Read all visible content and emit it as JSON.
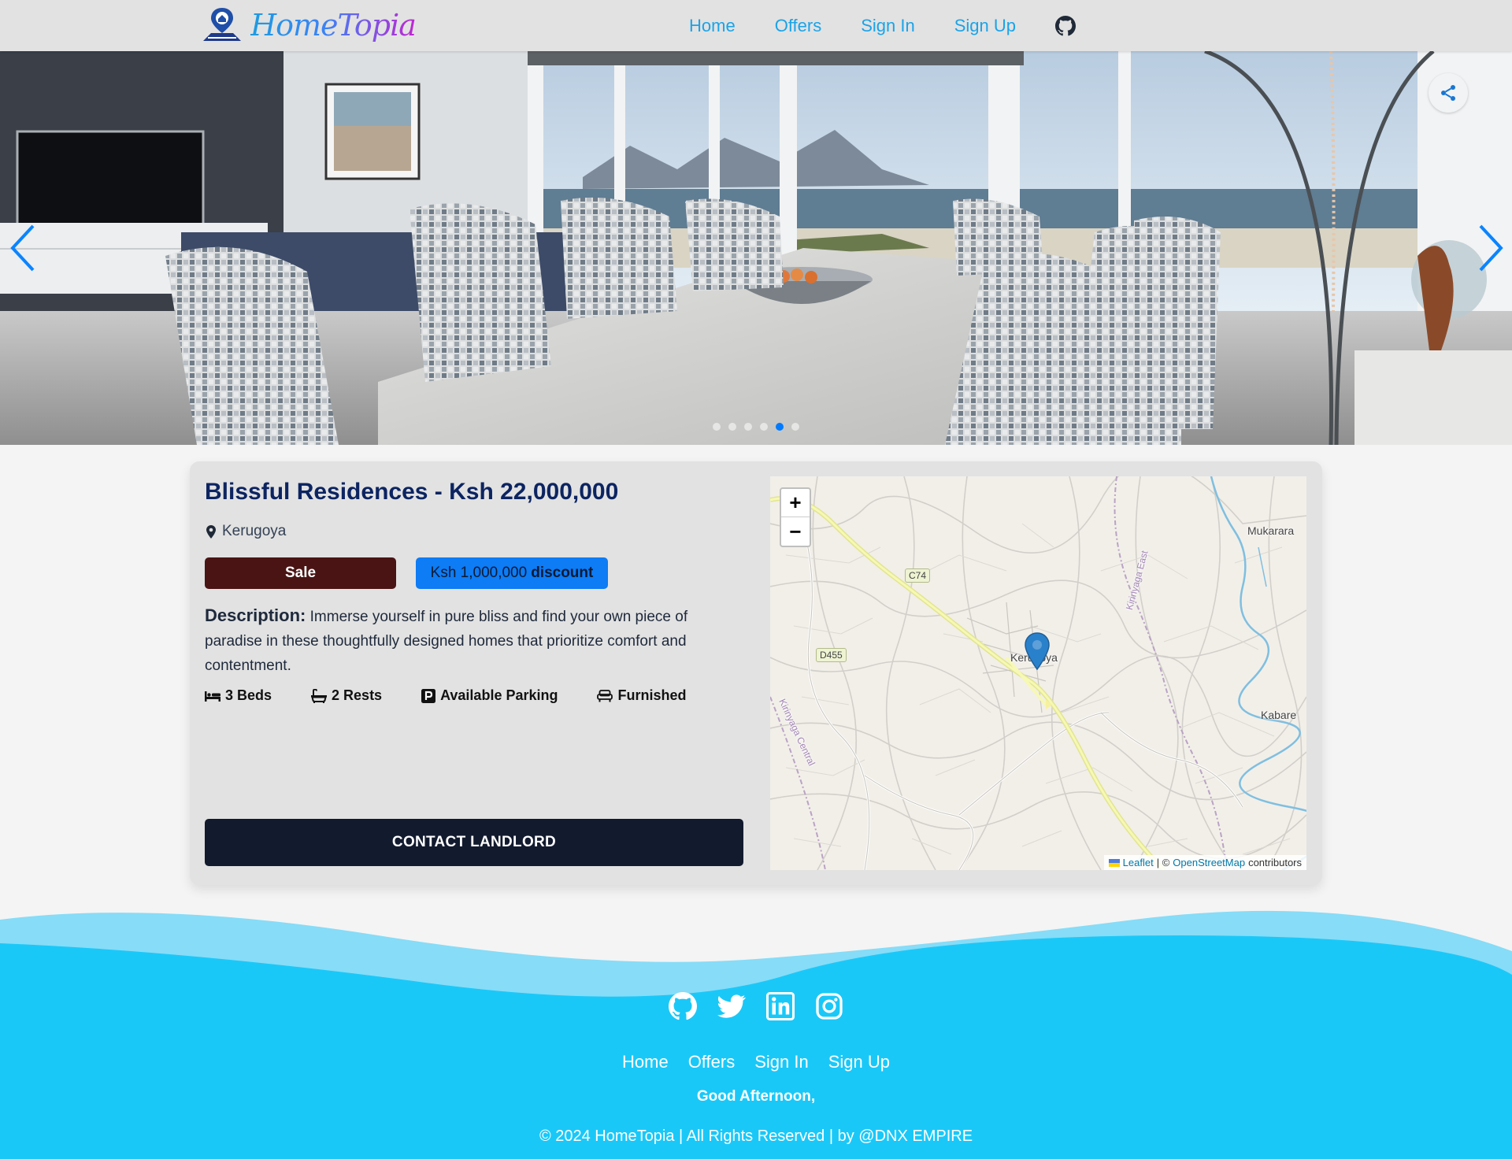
{
  "brand": {
    "name": "HomeTopia"
  },
  "nav": {
    "links": [
      "Home",
      "Offers",
      "Sign In",
      "Sign Up"
    ]
  },
  "hero": {
    "slide_count": 6,
    "active_slide": 5
  },
  "listing": {
    "title": "Blissful Residences - Ksh 22,000,000",
    "location": "Kerugoya",
    "sale_label": "Sale",
    "discount_amount": "Ksh 1,000,000",
    "discount_label": "discount",
    "description_label": "Description:",
    "description": "Immerse yourself in pure bliss and find your own piece of paradise in these thoughtfully designed homes that prioritize comfort and contentment.",
    "features": [
      "3 Beds",
      "2 Rests",
      "Available Parking",
      "Furnished"
    ],
    "contact_label": "CONTACT LANDLORD"
  },
  "map": {
    "zoom_in": "+",
    "zoom_out": "−",
    "labels": [
      "Mukarara",
      "Kerugoya",
      "Kabare",
      "Kirinyaga East",
      "Kirinyaga Central"
    ],
    "road_shields": [
      "C74",
      "D455"
    ],
    "attribution": {
      "leaflet": "Leaflet",
      "sep": "| ©",
      "osm": "OpenStreetMap",
      "suffix": "contributors"
    }
  },
  "footer": {
    "links": [
      "Home",
      "Offers",
      "Sign In",
      "Sign Up"
    ],
    "greeting": "Good Afternoon,",
    "copyright": "© 2024 HomeTopia | All Rights Reserved | by @DNX EMPIRE"
  },
  "colors": {
    "accent": "#1aa3e8",
    "footer": "#1ac8f8",
    "title": "#0c2461",
    "sale": "#4a1414",
    "discount": "#0d7cf5",
    "button": "#121a2e"
  }
}
